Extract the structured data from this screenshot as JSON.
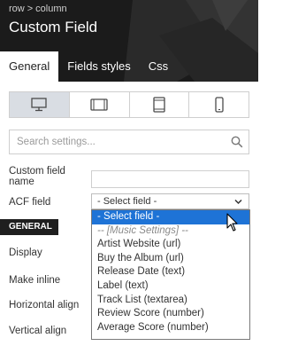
{
  "breadcrumb": {
    "parent": "row",
    "separator": ">",
    "current": "column"
  },
  "header": {
    "title": "Custom Field"
  },
  "tabs": [
    {
      "label": "General",
      "active": true
    },
    {
      "label": "Fields styles",
      "active": false
    },
    {
      "label": "Css",
      "active": false
    }
  ],
  "devices": [
    {
      "icon": "desktop-icon",
      "active": true
    },
    {
      "icon": "tablet-landscape-icon",
      "active": false
    },
    {
      "icon": "tablet-portrait-icon",
      "active": false
    },
    {
      "icon": "mobile-icon",
      "active": false
    }
  ],
  "search": {
    "placeholder": "Search settings...",
    "value": ""
  },
  "fields": {
    "custom_field_name": {
      "label_line1": "Custom field",
      "label_line2": "name",
      "value": ""
    },
    "acf_field": {
      "label": "ACF field",
      "selected": "- Select field -"
    }
  },
  "section": {
    "general": "GENERAL"
  },
  "settings": {
    "display": "Display",
    "make_inline": "Make inline",
    "horizontal_align": "Horizontal align",
    "vertical_align": "Vertical align"
  },
  "dropdown": {
    "options": [
      "- Select field -",
      "-- [Music Settings] --",
      "Artist Website (url)",
      "Buy the Album (url)",
      "Release Date (text)",
      "Label (text)",
      "Track List (textarea)",
      "Review Score (number)",
      "Average Score (number)"
    ]
  },
  "colors": {
    "header_bg": "#1b1b1b",
    "selected_option": "#1e73d6",
    "section_bg": "#1f1f1f"
  }
}
